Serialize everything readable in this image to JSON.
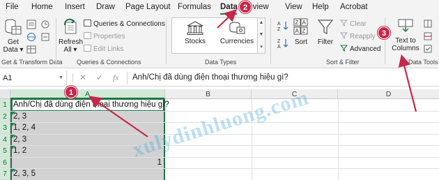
{
  "menu": {
    "tabs": [
      "File",
      "Home",
      "Insert",
      "Draw",
      "Page Layout",
      "Formulas",
      "Data",
      "Review",
      "View",
      "Help",
      "Acrobat"
    ],
    "active_tab": "Data"
  },
  "ribbon": {
    "get_transform": {
      "get_data_label_1": "Get",
      "get_data_label_2": "Data",
      "group_label": "Get & Transform Data"
    },
    "queries": {
      "refresh_label_1": "Refresh",
      "refresh_label_2": "All",
      "queries_connections": "Queries & Connections",
      "properties": "Properties",
      "edit_links": "Edit Links",
      "group_label": "Queries & Connections"
    },
    "data_types": {
      "stocks": "Stocks",
      "currencies": "Currencies",
      "group_label": "Data Types"
    },
    "sort_filter": {
      "sort": "Sort",
      "filter": "Filter",
      "clear": "Clear",
      "reapply": "Reapply",
      "advanced": "Advanced",
      "group_label": "Sort & Filter"
    },
    "data_tools": {
      "text_to_columns_1": "Text to",
      "text_to_columns_2": "Columns",
      "group_label": "Data Tools"
    }
  },
  "formula_bar": {
    "name_box": "A1",
    "fx": "fx",
    "content": "Anh/Chị đã dùng điện thoại thương hiệu gì?"
  },
  "grid": {
    "columns": [
      "A",
      "B",
      "C",
      "D"
    ],
    "rows": [
      {
        "num": "1",
        "value": "Anh/Chị đã dùng điện thoại thương hiệu gì?",
        "right": ""
      },
      {
        "num": "2",
        "value": "2, 3",
        "right": ""
      },
      {
        "num": "3",
        "value": "1, 2, 4",
        "right": ""
      },
      {
        "num": "4",
        "value": "2, 3",
        "right": ""
      },
      {
        "num": "5",
        "value": "1, 2",
        "right": ""
      },
      {
        "num": "6",
        "value": "",
        "right": "1"
      },
      {
        "num": "7",
        "value": "2, 3, 5",
        "right": ""
      }
    ]
  },
  "annotations": {
    "badge_1": "1",
    "badge_2": "2",
    "badge_3": "3",
    "badge_color": "#c6284a",
    "watermark": "xulydinhluong.com"
  },
  "colors": {
    "accent": "#217346",
    "selection": "#d2e9d8",
    "arrow": "#c6284a"
  }
}
